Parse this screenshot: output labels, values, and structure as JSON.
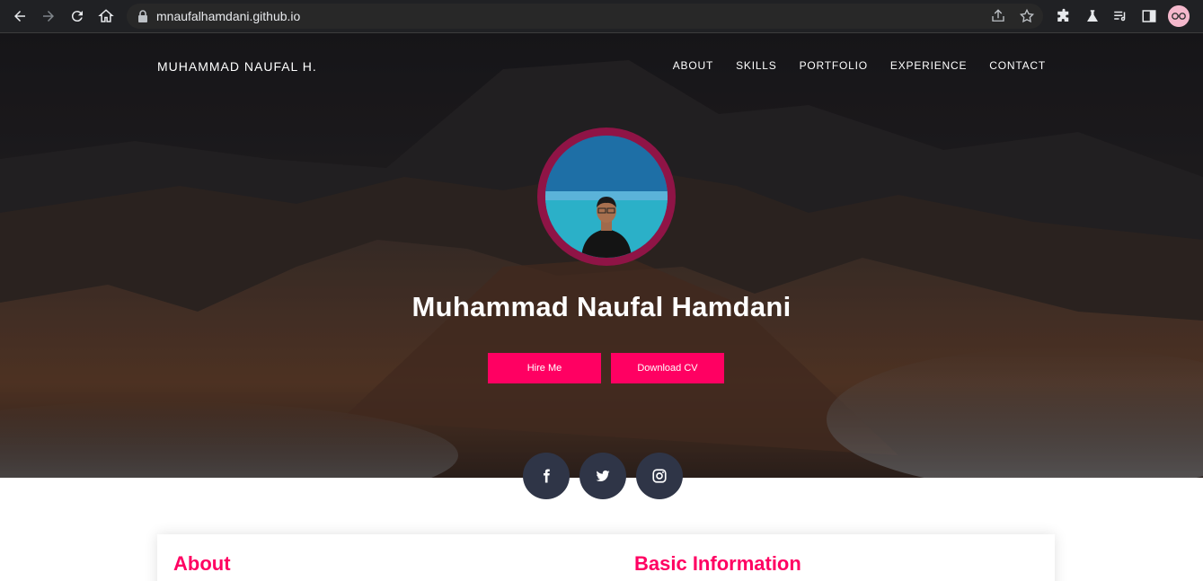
{
  "browser": {
    "url": "mnaufalhamdani.github.io",
    "icons": [
      "back-icon",
      "forward-icon",
      "reload-icon",
      "home-icon",
      "lock-icon",
      "share-icon",
      "star-icon",
      "extensions-icon",
      "labs-icon",
      "reading-list-icon",
      "side-panel-icon",
      "profile-avatar"
    ]
  },
  "header": {
    "brand": "MUHAMMAD NAUFAL H.",
    "nav": [
      "ABOUT",
      "SKILLS",
      "PORTFOLIO",
      "EXPERIENCE",
      "CONTACT"
    ]
  },
  "hero": {
    "name": "Muhammad Naufal Hamdani",
    "buttons": {
      "hire": "Hire Me",
      "cv": "Download CV"
    }
  },
  "social": [
    "facebook-icon",
    "twitter-icon",
    "instagram-icon"
  ],
  "sections": {
    "about": "About",
    "basic": "Basic Information"
  },
  "colors": {
    "accent": "#ff0062",
    "profile_ring": "#8f1446",
    "social_bg": "#2f3547",
    "chrome_bg": "#202124"
  }
}
